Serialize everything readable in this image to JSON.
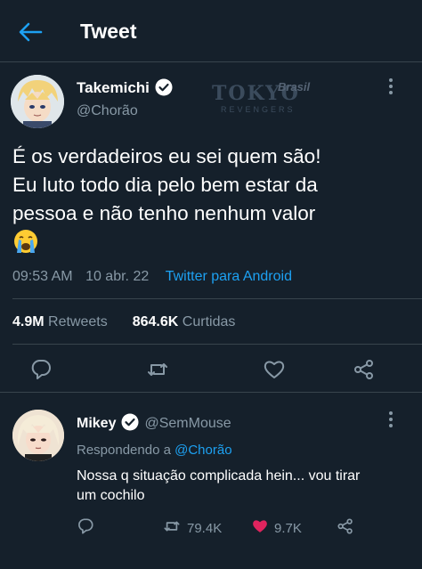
{
  "header": {
    "title": "Tweet"
  },
  "main_tweet": {
    "name": "Takemichi",
    "handle": "@Chorão",
    "logo": {
      "line1": "TOKYO",
      "line2": "Brasil",
      "line3": "REVENGERS"
    },
    "text_line1": " É os verdadeiros eu sei quem são!",
    "text_line2": "Eu luto todo dia pelo bem estar da",
    "text_line3": "pessoa e não tenho nenhum valor",
    "emoji": "crying-face",
    "time": "09:53 AM",
    "date": "10 abr. 22",
    "source": "Twitter para Android",
    "retweets_count": "4.9M",
    "retweets_label": "Retweets",
    "likes_count": "864.6K",
    "likes_label": "Curtidas"
  },
  "reply": {
    "name": "Mikey",
    "handle": "@SemMouse",
    "replying_prefix": "Respondendo a",
    "replying_to": "@Chorão",
    "text_line1": "Nossa q situação complicada hein... vou tirar",
    "text_line2": "um cochilo",
    "retweets": "79.4K",
    "likes": "9.7K"
  },
  "colors": {
    "background": "#15202b",
    "accent": "#1da1f2",
    "muted": "#8899a6",
    "like_active": "#e0245e"
  }
}
